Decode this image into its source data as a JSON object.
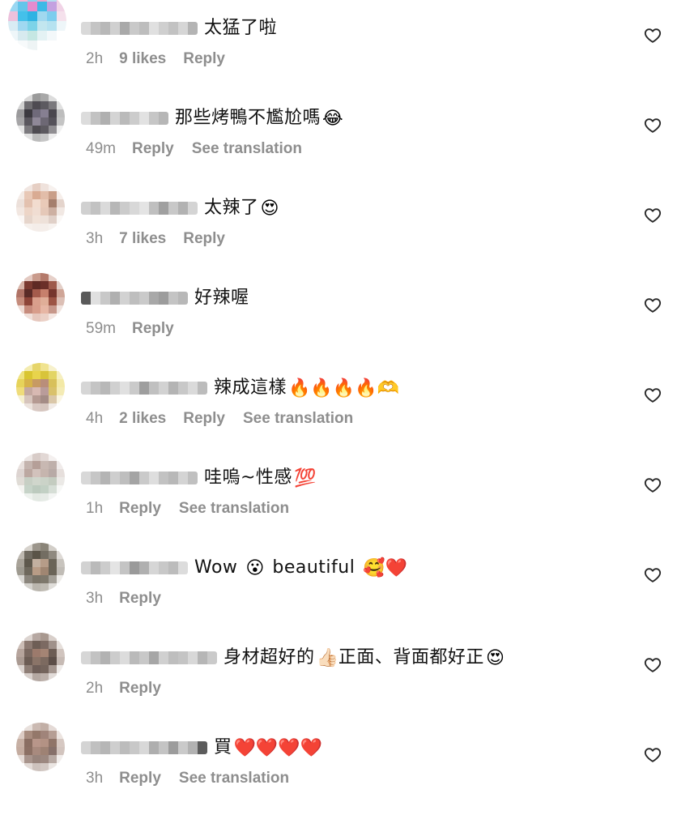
{
  "comments": [
    {
      "text": "太猛了啦",
      "emoji": "",
      "time": "2h",
      "likes": "9 likes",
      "reply": "Reply",
      "see_translation": "",
      "avatar_colors": [
        "#c9e4f0",
        "#f2b8d8",
        "#8fd0ee",
        "#e9a7cf",
        "#b7dff0",
        "#f7c9e1",
        "#9ad7f2",
        "#62c5ea",
        "#e48ccf",
        "#3db9e6",
        "#c4a1e0",
        "#f1d3e6",
        "#ecc1dc",
        "#44c0ea",
        "#2fb3e3",
        "#a0d8ef",
        "#7dcdee",
        "#f5e1ec",
        "#d9ecf4",
        "#9fd8f1",
        "#7cd3e8",
        "#c2e6ef",
        "#b6e2f0",
        "#eef6f9",
        "#eef6f9",
        "#d7eaef",
        "#c5e7e3",
        "#e4f2f4",
        "#f3f8fa",
        "#ffffff",
        "#ffffff",
        "#f7fafb",
        "#eef4f5",
        "#ffffff",
        "#ffffff",
        "#ffffff"
      ],
      "username_colors": [
        "#d9d9d9",
        "#c4c4c4",
        "#b8b8b8",
        "#d0d0d0",
        "#a9a9a9",
        "#c9c9c9",
        "#bdbdbd",
        "#e0e0e0",
        "#cfcfcf",
        "#c2c2c2",
        "#d6d6d6",
        "#b4b4b4"
      ]
    },
    {
      "text": "那些烤鴨不尷尬嗎",
      "emoji": "😂",
      "time": "49m",
      "likes": "",
      "reply": "Reply",
      "see_translation": "See translation",
      "avatar_colors": [
        "#ffffff",
        "#d8d8d8",
        "#9a9a9a",
        "#a8a8a8",
        "#dcdcdc",
        "#ffffff",
        "#d1d1d1",
        "#6e6c70",
        "#4e4b52",
        "#5c5a60",
        "#7a787c",
        "#e0e0e0",
        "#9b9a9c",
        "#3c3a40",
        "#6f6a7a",
        "#867f91",
        "#4a474e",
        "#bdbdbd",
        "#a6a5a7",
        "#5a575e",
        "#8f8898",
        "#6d6874",
        "#55525a",
        "#c4c4c4",
        "#e4e4e4",
        "#7c7a7e",
        "#4f4c52",
        "#5d5a60",
        "#908e92",
        "#f0f0f0",
        "#ffffff",
        "#e2e2e2",
        "#bcbcbc",
        "#c6c6c6",
        "#ececec",
        "#ffffff"
      ],
      "username_colors": [
        "#dcdcdc",
        "#c2c2c2",
        "#b0b0b0",
        "#d4d4d4",
        "#bababa",
        "#cccccc",
        "#e2e2e2",
        "#c6c6c6",
        "#b6b6b6"
      ]
    },
    {
      "text": "太辣了",
      "emoji": "😍",
      "time": "3h",
      "likes": "7 likes",
      "reply": "Reply",
      "see_translation": "",
      "avatar_colors": [
        "#ffffff",
        "#f1e6e1",
        "#e6cfc4",
        "#efe2dc",
        "#f7f1ee",
        "#ffffff",
        "#f4ebe6",
        "#e8c8b6",
        "#d9ab93",
        "#e2bda9",
        "#c99e88",
        "#f6eeea",
        "#ece0da",
        "#e3c1af",
        "#f2dccf",
        "#e9cab8",
        "#a57f6d",
        "#e4d4cc",
        "#f2e7e1",
        "#edd5c7",
        "#f0ddd2",
        "#e5c8b8",
        "#cdb0a2",
        "#f1e8e3",
        "#fbf7f5",
        "#e6d5cb",
        "#f1e2d8",
        "#eee1d9",
        "#e0d0c8",
        "#fbf8f6",
        "#ffffff",
        "#f6f0ec",
        "#f4ede9",
        "#f5eeea",
        "#f7f2ef",
        "#ffffff"
      ],
      "username_colors": [
        "#d0d0d0",
        "#c2c2c2",
        "#dadada",
        "#b7b7b7",
        "#cbcbcb",
        "#d8d8d8",
        "#e4e4e4",
        "#bfbfbf",
        "#a0a0a0",
        "#c8c8c8",
        "#b2b2b2",
        "#d4d4d4"
      ]
    },
    {
      "text": "好辣喔",
      "emoji": "",
      "time": "59m",
      "likes": "",
      "reply": "Reply",
      "see_translation": "",
      "avatar_colors": [
        "#ffffff",
        "#e3c9c1",
        "#c99b8c",
        "#b47a6b",
        "#e6d0c9",
        "#ffffff",
        "#d7b4a8",
        "#7a3a30",
        "#5e2a24",
        "#6b2f28",
        "#9e5a4b",
        "#e3cfc8",
        "#b07366",
        "#5a2b27",
        "#a45b4c",
        "#c7806c",
        "#76362d",
        "#cfa597",
        "#c58c7c",
        "#8d4438",
        "#d99f8c",
        "#e0ae98",
        "#9c5444",
        "#dcbfb5",
        "#edd9d2",
        "#c68b7c",
        "#d89d8b",
        "#e7b6a4",
        "#c7978a",
        "#f1e3de",
        "#ffffff",
        "#f0dfd9",
        "#e6c7bd",
        "#ebd0c6",
        "#f4e6e1",
        "#ffffff"
      ],
      "username_colors": [
        "#5a5a5a",
        "#e0e0e0",
        "#c8c8c8",
        "#b0b0b0",
        "#d2d2d2",
        "#bebebe",
        "#cacaca",
        "#a8a8a8",
        "#9c9c9c",
        "#c4c4c4",
        "#b8b8b8"
      ]
    },
    {
      "text": "辣成這樣",
      "emoji": "🔥🔥🔥🔥🫶",
      "time": "4h",
      "likes": "2 likes",
      "reply": "Reply",
      "see_translation": "See translation",
      "avatar_colors": [
        "#ffffff",
        "#f4ecb0",
        "#e6d56a",
        "#f0e390",
        "#f7f1cc",
        "#ffffff",
        "#efe27e",
        "#d9c531",
        "#e8d44c",
        "#d8c43a",
        "#e3d565",
        "#f6efc0",
        "#e6d35a",
        "#d6b24a",
        "#c79a63",
        "#b98e7a",
        "#d8c05a",
        "#f3e9a6",
        "#efdc7a",
        "#c4a8a0",
        "#d8b9b2",
        "#b99c9a",
        "#d9c16b",
        "#f4ebb4",
        "#f5efcf",
        "#d6c4bc",
        "#b59a92",
        "#a48c86",
        "#dac7a8",
        "#fbf6e2",
        "#ffffff",
        "#ece3dd",
        "#d9c9c3",
        "#d6c6bf",
        "#f1ebe6",
        "#ffffff"
      ],
      "username_colors": [
        "#d6d6d6",
        "#c4c4c4",
        "#b8b8b8",
        "#d0d0d0",
        "#e0e0e0",
        "#cacaca",
        "#9e9e9e",
        "#c0c0c0",
        "#d2d2d2",
        "#b4b4b4",
        "#c8c8c8",
        "#dadada",
        "#bcbcbc"
      ]
    },
    {
      "text": "哇嗚~性感",
      "emoji": "💯",
      "time": "1h",
      "likes": "",
      "reply": "Reply",
      "see_translation": "See translation",
      "avatar_colors": [
        "#ffffff",
        "#ece6e4",
        "#d8ccc8",
        "#e2d8d5",
        "#f4f0ef",
        "#ffffff",
        "#e8e0dd",
        "#c4b4ae",
        "#b59f98",
        "#c8b8b2",
        "#bfb0ab",
        "#f0ebea",
        "#ddd4d1",
        "#bca8a1",
        "#d2c2bc",
        "#c6b5ae",
        "#b8aaa6",
        "#e6dfdc",
        "#e0dcd6",
        "#c7cfc4",
        "#d0d6cc",
        "#cbd3c8",
        "#c4ccc0",
        "#ebe9e6",
        "#f4f4f1",
        "#c6d3c8",
        "#bccabe",
        "#c2d0c4",
        "#d6ded6",
        "#f7f8f6",
        "#ffffff",
        "#eef2ee",
        "#e3e9e3",
        "#e6ebe6",
        "#f3f5f3",
        "#ffffff"
      ],
      "username_colors": [
        "#d8d8d8",
        "#c6c6c6",
        "#b4b4b4",
        "#cecece",
        "#bebebe",
        "#a4a4a4",
        "#cacaca",
        "#dedede",
        "#c2c2c2",
        "#b8b8b8",
        "#d4d4d4",
        "#c0c0c0"
      ]
    },
    {
      "text": "Wow",
      "emoji": "😮",
      "text2": "beautiful",
      "emoji2": "🥰❤️",
      "time": "3h",
      "likes": "",
      "reply": "Reply",
      "see_translation": "",
      "avatar_colors": [
        "#ffffff",
        "#d6d2cc",
        "#9c968c",
        "#8a8478",
        "#d2cec8",
        "#ffffff",
        "#bdb8b0",
        "#6f6a60",
        "#5a5448",
        "#736d62",
        "#8f897f",
        "#dedad6",
        "#a8a298",
        "#5e584c",
        "#c2b0a0",
        "#b69c88",
        "#6a6458",
        "#c8c4be",
        "#9e9a90",
        "#6e685c",
        "#b89c86",
        "#a08672",
        "#6a6458",
        "#c0bcb6",
        "#d8d6d2",
        "#8a857c",
        "#7a7468",
        "#7e786c",
        "#a4a098",
        "#eeece9",
        "#ffffff",
        "#d4d2cd",
        "#bab6ae",
        "#c0bcb4",
        "#e0deda",
        "#ffffff"
      ],
      "username_colors": [
        "#d2d2d2",
        "#bababa",
        "#cccccc",
        "#e4e4e4",
        "#c4c4c4",
        "#9a9a9a",
        "#b0b0b0",
        "#d6d6d6",
        "#c8c8c8",
        "#bcbcbc",
        "#dcdcdc"
      ]
    },
    {
      "text": "身材超好的",
      "emoji": "👍🏻",
      "text2": "正面、背面都好正",
      "emoji2": "😍",
      "time": "2h",
      "likes": "",
      "reply": "Reply",
      "see_translation": "",
      "avatar_colors": [
        "#ffffff",
        "#dcd4d0",
        "#b6a8a2",
        "#a8988f",
        "#d8cfca",
        "#ffffff",
        "#cbbdb6",
        "#8c7a72",
        "#6e5e56",
        "#7c6a62",
        "#a0918a",
        "#e6dfdb",
        "#b6a49c",
        "#7a6860",
        "#9c7a6c",
        "#a48474",
        "#6c5c54",
        "#d0c4be",
        "#aa9a92",
        "#6c5c54",
        "#8a7468",
        "#7c6a60",
        "#5c4e48",
        "#c6bab4",
        "#dad2ce",
        "#8e7e76",
        "#6e5e58",
        "#74645c",
        "#a4968f",
        "#efebe9",
        "#ffffff",
        "#d8d0cc",
        "#b4a8a2",
        "#bcb0aa",
        "#e2dcd9",
        "#ffffff"
      ],
      "username_colors": [
        "#d6d6d6",
        "#c2c2c2",
        "#b2b2b2",
        "#cccccc",
        "#dcdcdc",
        "#bababa",
        "#c8c8c8",
        "#a6a6a6",
        "#d0d0d0",
        "#bebebe",
        "#c4c4c4",
        "#d8d8d8",
        "#b6b6b6",
        "#cacaca"
      ]
    },
    {
      "text": "買",
      "emoji": "❤️❤️❤️❤️",
      "time": "3h",
      "likes": "",
      "reply": "Reply",
      "see_translation": "See translation",
      "avatar_colors": [
        "#ffffff",
        "#e8e0dc",
        "#cbbab2",
        "#c2afa6",
        "#e4dad6",
        "#ffffff",
        "#dccbc3",
        "#a88c7e",
        "#94786a",
        "#a0847a",
        "#b69e94",
        "#ece4e0",
        "#c7b0a4",
        "#8a6e62",
        "#b8968a",
        "#b39284",
        "#8f7468",
        "#d6c8c2",
        "#c4aca0",
        "#8c7064",
        "#a88a7e",
        "#9e8274",
        "#86706a",
        "#d2c4be",
        "#e4dad5",
        "#a8948c",
        "#98847c",
        "#9c8880",
        "#b8aaa4",
        "#f2eeec",
        "#ffffff",
        "#e2dad6",
        "#cdc2bd",
        "#d2c8c3",
        "#ebe6e3",
        "#ffffff"
      ],
      "username_colors": [
        "#d4d4d4",
        "#c0c0c0",
        "#b6b6b6",
        "#cecece",
        "#bcbcbc",
        "#c8c8c8",
        "#d8d8d8",
        "#aeaeae",
        "#c4c4c4",
        "#9c9c9c",
        "#cacaca",
        "#b2b2b2",
        "#5c5c5c"
      ]
    }
  ]
}
